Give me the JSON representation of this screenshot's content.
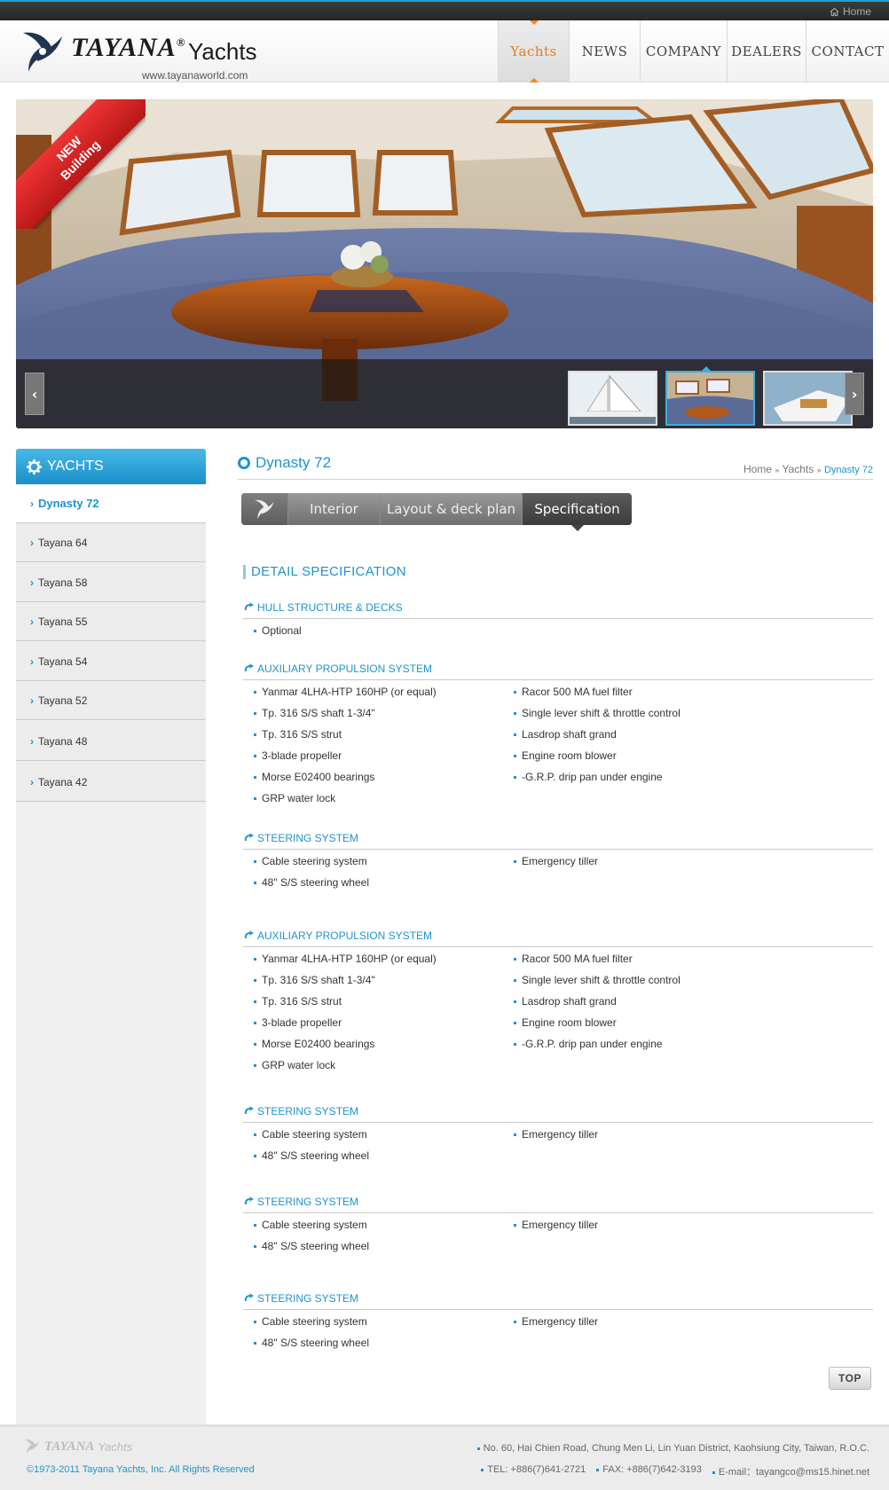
{
  "topbar": {
    "home_label": "Home"
  },
  "header": {
    "brand": "TAYANA",
    "brand_suffix": "Yachts",
    "url": "www.tayanaworld.com",
    "nav": [
      {
        "label": "Yachts",
        "active": true
      },
      {
        "label": "NEWS"
      },
      {
        "label": "COMPANY"
      },
      {
        "label": "DEALERS"
      },
      {
        "label": "CONTACT"
      }
    ]
  },
  "banner": {
    "badge_line1": "NEW",
    "badge_line2": "Building",
    "prev_icon": "chevron-left-icon",
    "next_icon": "chevron-right-icon"
  },
  "sidebar": {
    "title": "YACHTS",
    "items": [
      {
        "label": "Dynasty 72",
        "active": true
      },
      {
        "label": "Tayana 64"
      },
      {
        "label": "Tayana 58"
      },
      {
        "label": "Tayana 55"
      },
      {
        "label": "Tayana 54"
      },
      {
        "label": "Tayana 52"
      },
      {
        "label": "Tayana 48"
      },
      {
        "label": "Tayana 42"
      }
    ]
  },
  "main": {
    "title": "Dynasty 72",
    "breadcrumb": {
      "home": "Home",
      "yachts": "Yachts",
      "sep": "»",
      "current": "Dynasty 72"
    },
    "tabs": [
      {
        "label": "Interior"
      },
      {
        "label": "Layout & deck plan"
      },
      {
        "label": "Specification",
        "active": true
      }
    ],
    "detail_heading": "DETAIL SPECIFICATION",
    "sections": [
      {
        "title": "HULL STRUCTURE & DECKS",
        "left": [
          "Optional"
        ],
        "right": []
      },
      {
        "title": "AUXILIARY PROPULSION SYSTEM",
        "left": [
          "Yanmar 4LHA-HTP 160HP (or equal)",
          "Tp. 316 S/S shaft 1-3/4\"",
          "Tp. 316 S/S strut",
          "3-blade propeller",
          "Morse E02400 bearings",
          "GRP water lock"
        ],
        "right": [
          "Racor 500 MA fuel filter",
          "Single lever shift & throttle control",
          "Lasdrop shaft grand",
          "Engine room blower",
          "-G.R.P. drip pan under engine"
        ]
      },
      {
        "title": "STEERING SYSTEM",
        "left": [
          "Cable steering system",
          "48\" S/S steering wheel"
        ],
        "right": [
          "Emergency tiller"
        ]
      },
      {
        "title": "AUXILIARY PROPULSION SYSTEM",
        "left": [
          "Yanmar 4LHA-HTP 160HP (or equal)",
          "Tp. 316 S/S shaft 1-3/4\"",
          "Tp. 316 S/S strut",
          "3-blade propeller",
          "Morse E02400 bearings",
          "GRP water lock"
        ],
        "right": [
          "Racor 500 MA fuel filter",
          "Single lever shift & throttle control",
          "Lasdrop shaft grand",
          "Engine room blower",
          "-G.R.P. drip pan under engine"
        ]
      },
      {
        "title": "STEERING SYSTEM",
        "left": [
          "Cable steering system",
          "48\" S/S steering wheel"
        ],
        "right": [
          "Emergency tiller"
        ]
      },
      {
        "title": "STEERING SYSTEM",
        "left": [
          "Cable steering system",
          "48\" S/S steering wheel"
        ],
        "right": [
          "Emergency tiller"
        ]
      },
      {
        "title": "STEERING SYSTEM",
        "left": [
          "Cable steering system",
          "48\" S/S steering wheel"
        ],
        "right": [
          "Emergency tiller"
        ]
      }
    ],
    "top_button": "TOP"
  },
  "footer": {
    "logo_brand": "TAYANA",
    "logo_suffix": "Yachts",
    "copyright": "©1973-2011 Tayana Yachts, Inc. All Rights Reserved",
    "address": "No. 60, Hai Chien Road, Chung Men Li, Lin Yuan District, Kaohsiung City, Taiwan, R.O.C.",
    "tel": "TEL: +886(7)641-2721",
    "fax": "FAX: +886(7)642-3193",
    "email": "E-mail：tayangco@ms15.hinet.net"
  },
  "colors": {
    "accent": "#1f93cc",
    "nav_active": "#e57e1a",
    "ribbon": "#d42a2a"
  }
}
